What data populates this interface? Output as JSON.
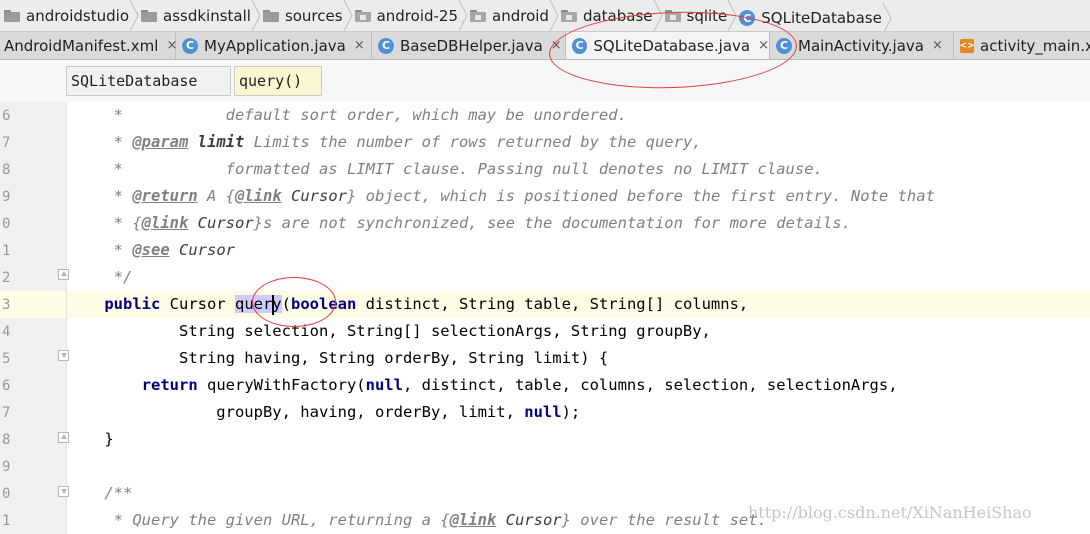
{
  "breadcrumb": {
    "items": [
      {
        "label": "androidstudio",
        "icon": "folder-icon"
      },
      {
        "label": "assdkinstall",
        "icon": "folder-icon"
      },
      {
        "label": "sources",
        "icon": "folder-icon"
      },
      {
        "label": "android-25",
        "icon": "package-icon"
      },
      {
        "label": "android",
        "icon": "package-icon"
      },
      {
        "label": "database",
        "icon": "package-icon"
      },
      {
        "label": "sqlite",
        "icon": "package-icon"
      },
      {
        "label": "SQLiteDatabase",
        "icon": "class-icon"
      }
    ]
  },
  "tabs": [
    {
      "label": "AndroidManifest.xml",
      "icon": "",
      "active": false
    },
    {
      "label": "MyApplication.java",
      "icon": "class-icon",
      "active": false
    },
    {
      "label": "BaseDBHelper.java",
      "icon": "class-icon",
      "active": false
    },
    {
      "label": "SQLiteDatabase.java",
      "icon": "class-icon",
      "active": true
    },
    {
      "label": "MainActivity.java",
      "icon": "class-icon",
      "active": false
    },
    {
      "label": "activity_main.x",
      "icon": "xml-icon",
      "active": false
    }
  ],
  "tab_close_glyph": "×",
  "method_breadcrumb": {
    "class_name": "SQLiteDatabase",
    "method_name": "query()"
  },
  "line_numbers": [
    "6",
    "7",
    "8",
    "9",
    "0",
    "1",
    "2",
    "3",
    "4",
    "5",
    "6",
    "7",
    "8",
    "9",
    "0",
    "1"
  ],
  "code": {
    "l0_a": "     *           default sort order, which may be unordered.",
    "l1_a": "     * ",
    "l1_tag": "@param",
    "l1_b": " ",
    "l1_param": "limit",
    "l1_c": " Limits the number of rows returned by the query,",
    "l2_a": "     *           formatted as LIMIT clause. Passing null denotes no LIMIT clause.",
    "l3_a": "     * ",
    "l3_tag": "@return",
    "l3_b": " A {",
    "l3_tag2": "@link",
    "l3_b2": " ",
    "l3_ref": "Cursor",
    "l3_c": "} object, which is positioned before the first entry. Note that",
    "l4_a": "     * {",
    "l4_tag": "@link",
    "l4_b": " ",
    "l4_ref": "Cursor",
    "l4_c": "}s are not synchronized, see the documentation for more details.",
    "l5_a": "     * ",
    "l5_tag": "@see",
    "l5_b": " ",
    "l5_ref": "Cursor",
    "l6_a": "     */",
    "l7_kw1": "public",
    "l7_a": " Cursor ",
    "l7_hl": "query",
    "l7_b": "(",
    "l7_kw2": "boolean",
    "l7_c": " distinct, String table, String[] columns,",
    "l8_a": "            String selection, String[] selectionArgs, String groupBy,",
    "l9_a": "            String having, String orderBy, String limit) {",
    "l10_a": "        ",
    "l10_kw": "return",
    "l10_b": " queryWithFactory(",
    "l10_kw2": "null",
    "l10_c": ", distinct, table, columns, selection, selectionArgs,",
    "l11_a": "                groupBy, having, orderBy, limit, ",
    "l11_kw": "null",
    "l11_b": ");",
    "l12_a": "    }",
    "l13_a": "",
    "l14_a": "    /**",
    "l15_a": "     * Query the given URL, returning a {",
    "l15_tag": "@link",
    "l15_b": " ",
    "l15_ref": "Cursor",
    "l15_c": "} over the result set."
  },
  "watermark": "http://blog.csdn.net/XiNanHeiShao",
  "colors": {
    "keyword": "#000080",
    "comment": "#808080",
    "highlight": "#ccccff",
    "annotation": "#e23c3c",
    "current_line": "#fefce4"
  }
}
